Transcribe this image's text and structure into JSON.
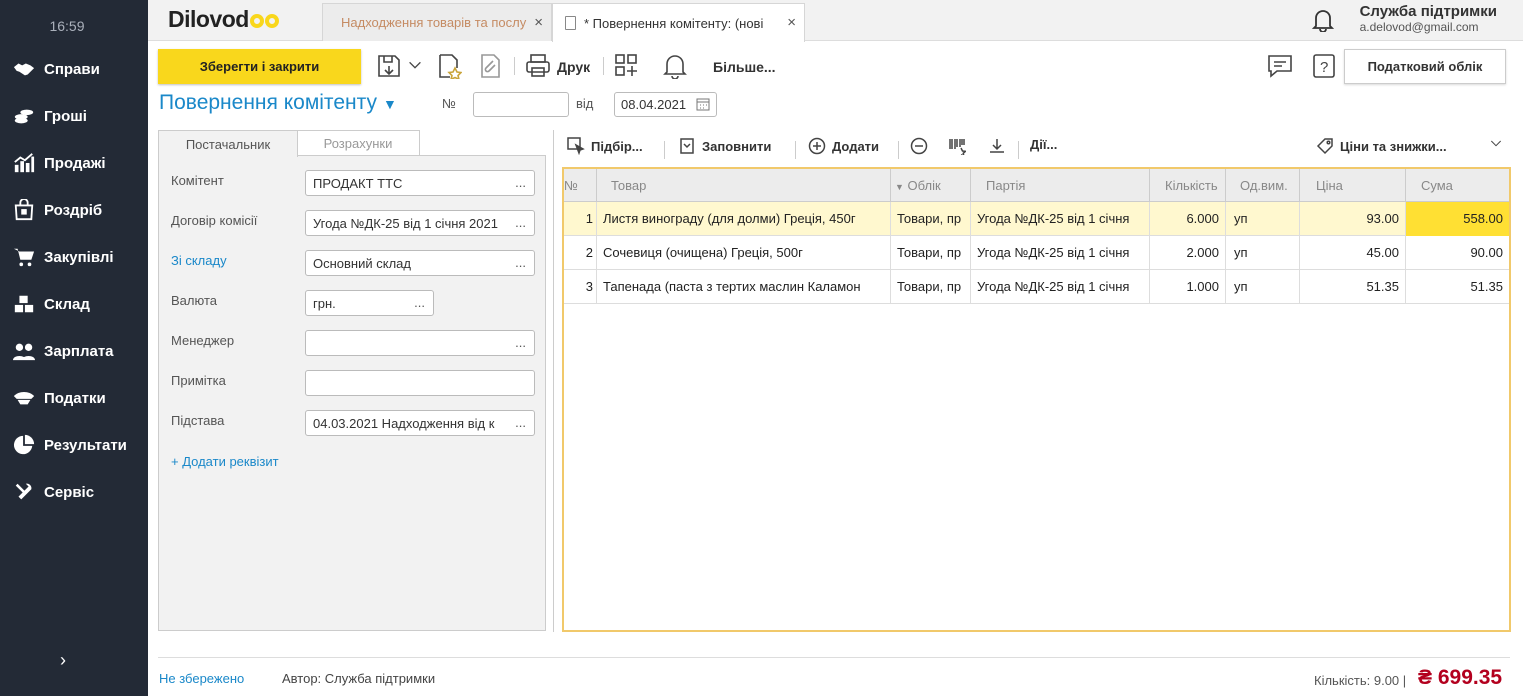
{
  "sidebar": {
    "time": "16:59",
    "items": [
      {
        "label": "Справи",
        "icon": "handshake-icon"
      },
      {
        "label": "Гроші",
        "icon": "coins-icon"
      },
      {
        "label": "Продажі",
        "icon": "chart-bars-icon"
      },
      {
        "label": "Роздріб",
        "icon": "shopping-bag-icon"
      },
      {
        "label": "Закупівлі",
        "icon": "cart-icon"
      },
      {
        "label": "Склад",
        "icon": "boxes-icon"
      },
      {
        "label": "Зарплата",
        "icon": "people-icon"
      },
      {
        "label": "Податки",
        "icon": "officer-cap-icon"
      },
      {
        "label": "Результати",
        "icon": "pie-chart-icon"
      },
      {
        "label": "Сервіс",
        "icon": "tools-icon"
      }
    ],
    "collapse_glyph": "›"
  },
  "topbar": {
    "logo": "Dilovod",
    "tabs": [
      {
        "label": "Надходження товарів та послу",
        "active": false
      },
      {
        "label": "* Повернення комітенту: (нові",
        "active": true
      }
    ],
    "close_glyph": "×",
    "support_name": "Служба підтримки",
    "support_email": "a.delovod@gmail.com"
  },
  "toolbar": {
    "save_close": "Зберегти і закрити",
    "print": "Друк",
    "more": "Більше...",
    "tax": "Податковий облік"
  },
  "document": {
    "title": "Повернення комітенту",
    "number_label": "№",
    "number_value": "",
    "date_label": "від",
    "date_value": "08.04.2021"
  },
  "panel": {
    "tabs": [
      "Постачальник",
      "Розрахунки"
    ],
    "fields": [
      {
        "label": "Комітент",
        "value": "ПРОДАКТ ТТС"
      },
      {
        "label": "Договір комісії",
        "value": "Угода №ДК-25 від 1 січня 2021"
      },
      {
        "label": "Зі складу",
        "value": "Основний склад"
      },
      {
        "label": "Валюта",
        "value": "грн."
      },
      {
        "label": "Менеджер",
        "value": ""
      },
      {
        "label": "Примітка",
        "value": ""
      },
      {
        "label": "Підстава",
        "value": "04.03.2021 Надходження від к"
      }
    ],
    "dots": "...",
    "add_requisite": "+ Додати реквізит"
  },
  "grid_toolbar": {
    "pick": "Підбір...",
    "fill": "Заповнити",
    "add": "Додати",
    "actions": "Дії...",
    "prices": "Ціни та знижки..."
  },
  "grid": {
    "columns": [
      "№",
      "Товар",
      "Облік",
      "Партія",
      "Кількість",
      "Од.вим.",
      "Ціна",
      "Сума"
    ],
    "rows": [
      {
        "n": "1",
        "product": "Листя винограду (для долми) Греція, 450г",
        "account": "Товари, пр",
        "batch": "Угода №ДК-25 від 1 січня",
        "qty": "6.000",
        "unit": "уп",
        "price": "93.00",
        "sum": "558.00"
      },
      {
        "n": "2",
        "product": "Сочевиця (очищена) Греція, 500г",
        "account": "Товари, пр",
        "batch": "Угода №ДК-25 від 1 січня",
        "qty": "2.000",
        "unit": "уп",
        "price": "45.00",
        "sum": "90.00"
      },
      {
        "n": "3",
        "product": "Тапенада (паста з тертих маслин Каламон",
        "account": "Товари, пр",
        "batch": "Угода №ДК-25 від 1 січня",
        "qty": "1.000",
        "unit": "уп",
        "price": "51.35",
        "sum": "51.35"
      }
    ]
  },
  "footer": {
    "status": "Не збережено",
    "author": "Автор: Служба підтримки",
    "quantity": "Кількість: 9.00 |",
    "total": "₴ 699.35"
  },
  "colors": {
    "accent_yellow": "#f9d71c",
    "link_blue": "#1a88c9",
    "sidebar_bg": "#232a36",
    "total_red": "#b3001e"
  }
}
